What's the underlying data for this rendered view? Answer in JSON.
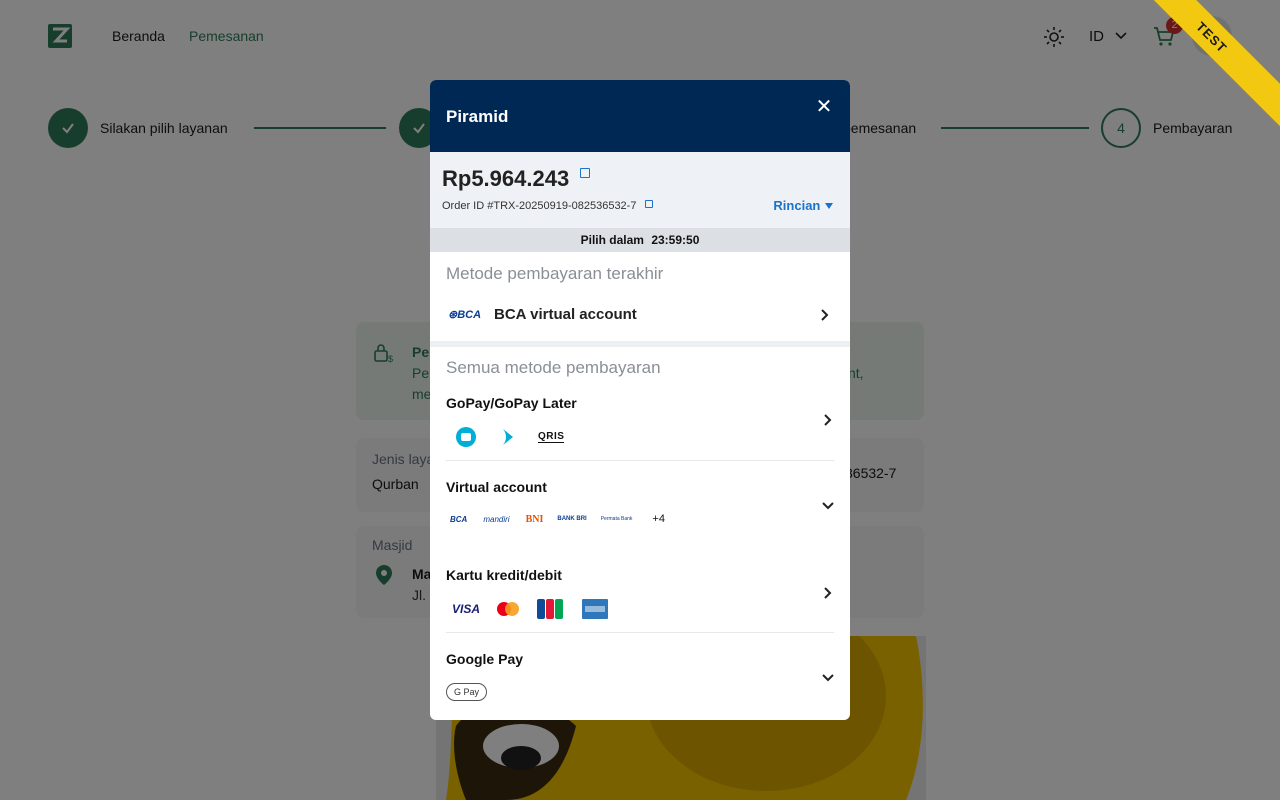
{
  "header": {
    "nav": [
      "Beranda",
      "Pemesanan"
    ],
    "language": "ID",
    "cart_count": "2",
    "ribbon": "TEST"
  },
  "stepper": {
    "steps": [
      {
        "label": "Silakan pilih layanan",
        "state": "done"
      },
      {
        "label": "",
        "state": "done"
      },
      {
        "label": "pemesanan",
        "state": "done"
      },
      {
        "label": "Pembayaran",
        "number": "4",
        "state": "current"
      }
    ]
  },
  "background": {
    "info_title": "Pe",
    "info_line1": "Per",
    "info_line1_tail": "nt,",
    "info_line2": "me",
    "jenis_label": "Jenis laya",
    "jenis_value": "Qurban",
    "order_tail": "36532-7",
    "masjid_label": "Masjid",
    "masjid_name": "Ma",
    "masjid_addr": "Jl. I"
  },
  "modal": {
    "title": "Piramid",
    "close": "✕",
    "amount": "Rp5.964.243",
    "order_id": "Order ID #TRX-20250919-082536532-7",
    "rincian": "Rincian",
    "timer_label": "Pilih dalam",
    "timer_value": "23:59:50",
    "recent_title": "Metode pembayaran terakhir",
    "recent_method": "BCA virtual account",
    "all_title": "Semua metode pembayaran",
    "methods": [
      {
        "title": "GoPay/GoPay Later",
        "logos": [
          "gopay-icon",
          "gopaylater-icon",
          "QRIS"
        ]
      },
      {
        "title": "Virtual account",
        "logos": [
          "BCA",
          "mandiri",
          "BNI",
          "BANK BRI",
          "Permata Bank"
        ],
        "more": "+4"
      },
      {
        "title": "Kartu kredit/debit",
        "logos": [
          "VISA",
          "mastercard",
          "JCB",
          "AMERICAN EXPRESS"
        ]
      },
      {
        "title": "Google Pay",
        "logos": [
          "G Pay"
        ]
      }
    ]
  },
  "colors": {
    "brand_green": "#2e7d5b",
    "modal_header": "#002855",
    "link_blue": "#1a73c9",
    "ribbon": "#f2c811"
  }
}
